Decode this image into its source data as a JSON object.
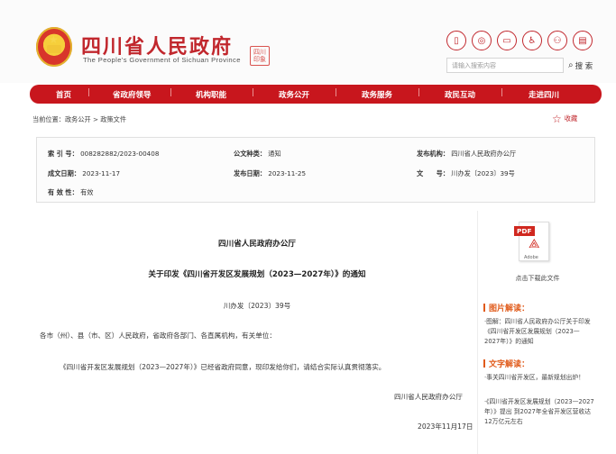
{
  "site": {
    "title": "四川省人民政府",
    "subtitle": "The People's Government of Sichuan Province",
    "seal_text": "四川 印象"
  },
  "header_tools": [
    {
      "icon": "mobile-icon",
      "glyph": "▯"
    },
    {
      "icon": "weibo-icon",
      "glyph": "◎"
    },
    {
      "icon": "message-icon",
      "glyph": "▭"
    },
    {
      "icon": "accessibility-icon",
      "glyph": "♿"
    },
    {
      "icon": "elderly-icon",
      "glyph": "⚇"
    },
    {
      "icon": "reader-icon",
      "glyph": "▤"
    }
  ],
  "search": {
    "placeholder": "请输入搜索内容",
    "button": "搜 索"
  },
  "nav": [
    "首页",
    "省政府领导",
    "机构职能",
    "政务公开",
    "政务服务",
    "政民互动",
    "走进四川"
  ],
  "breadcrumb": "当前位置：政务公开 > 政策文件",
  "favorite": "收藏",
  "meta": {
    "index_label": "索 引 号：",
    "index_value": "008282882/2023-00408",
    "type_label": "公文种类：",
    "type_value": "通知",
    "agency_label": "发布机构：",
    "agency_value": "四川省人民政府办公厅",
    "created_label": "成文日期：",
    "created_value": "2023-11-17",
    "published_label": "发布日期：",
    "published_value": "2023-11-25",
    "docno_label": "文　　号：",
    "docno_value": "川办发〔2023〕39号",
    "validity_label": "有 效 性：",
    "validity_value": "有效"
  },
  "article": {
    "issuer": "四川省人民政府办公厅",
    "title": "关于印发《四川省开发区发展规划（2023—2027年）》的通知",
    "doc_number": "川办发〔2023〕39号",
    "salutation": "各市（州）、县（市、区）人民政府，省政府各部门、各直属机构，有关单位：",
    "body": "《四川省开发区发展规划（2023—2027年）》已经省政府同意，现印发给你们，请结合实际认真贯彻落实。",
    "signature": "四川省人民政府办公厅",
    "date": "2023年11月17日"
  },
  "sidebar": {
    "pdf_tag": "PDF",
    "pdf_brand": "Adobe",
    "download": "点击下载此文件",
    "image_heading": "图片解读：",
    "image_text": "·图解：四川省人民政府办公厅关于印发《四川省开发区发展规划（2023—2027年）》的通知",
    "text_heading": "文字解读：",
    "text_item1": "·事关四川省开发区，最新规划出炉！",
    "text_item2": "·《四川省开发区发展规划（2023—2027年）》提出 到2027年全省开发区营收达12万亿元左右"
  }
}
